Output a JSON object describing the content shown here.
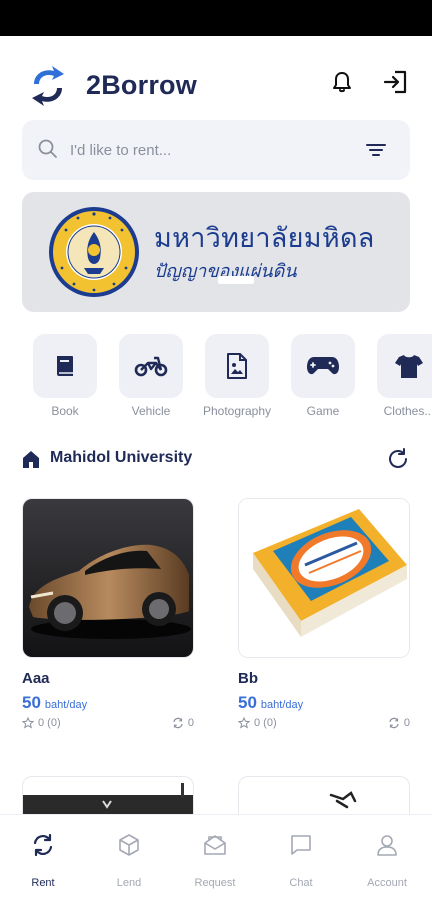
{
  "app": {
    "title": "2Borrow"
  },
  "search": {
    "placeholder": "I'd like to rent..."
  },
  "banner": {
    "title": "มหาวิทยาลัยมหิดล",
    "subtitle": "ปัญญาของแผ่นดิน"
  },
  "categories": [
    {
      "label": "Book",
      "icon": "book-icon"
    },
    {
      "label": "Vehicle",
      "icon": "motorcycle-icon"
    },
    {
      "label": "Photography",
      "icon": "image-file-icon"
    },
    {
      "label": "Game",
      "icon": "gamepad-icon"
    },
    {
      "label": "Clothes...",
      "icon": "shirt-icon"
    }
  ],
  "location": {
    "title": "Mahidol University"
  },
  "items": [
    {
      "title": "Aaa",
      "price": "50",
      "unit": "baht/day",
      "rating": "0 (0)",
      "rentals": "0"
    },
    {
      "title": "Bb",
      "price": "50",
      "unit": "baht/day",
      "rating": "0 (0)",
      "rentals": "0"
    }
  ],
  "nav": [
    {
      "label": "Rent",
      "active": true
    },
    {
      "label": "Lend",
      "active": false
    },
    {
      "label": "Request",
      "active": false
    },
    {
      "label": "Chat",
      "active": false
    },
    {
      "label": "Account",
      "active": false
    }
  ],
  "colors": {
    "brand": "#1f2a56",
    "accent": "#3a6fd8",
    "tile": "#eef0f5"
  }
}
